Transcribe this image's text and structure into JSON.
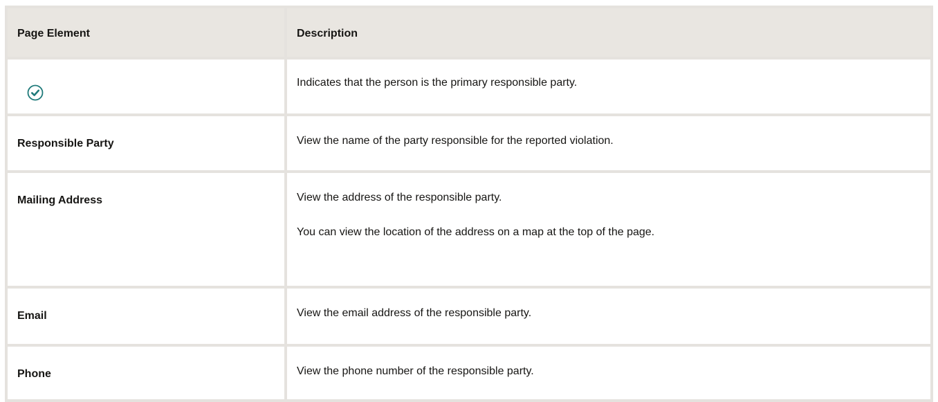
{
  "table": {
    "headers": {
      "page_element": "Page Element",
      "description": "Description"
    },
    "rows": [
      {
        "icon": "circle-check-icon",
        "description": [
          "Indicates that the person is the primary responsible party."
        ]
      },
      {
        "label": "Responsible Party",
        "description": [
          "View the name of the party responsible for the reported violation."
        ]
      },
      {
        "label": "Mailing Address",
        "description": [
          "View the address of the responsible party.",
          "You can view the location of the address on a map at the top of the page."
        ]
      },
      {
        "label": "Email",
        "description": [
          "View the email address of the responsible party."
        ]
      },
      {
        "label": "Phone",
        "description": [
          "View the phone number of the responsible party."
        ]
      }
    ]
  },
  "colors": {
    "border": "#e5e2de",
    "header_bg": "#e9e6e1",
    "icon_accent": "#1f7a7a"
  }
}
